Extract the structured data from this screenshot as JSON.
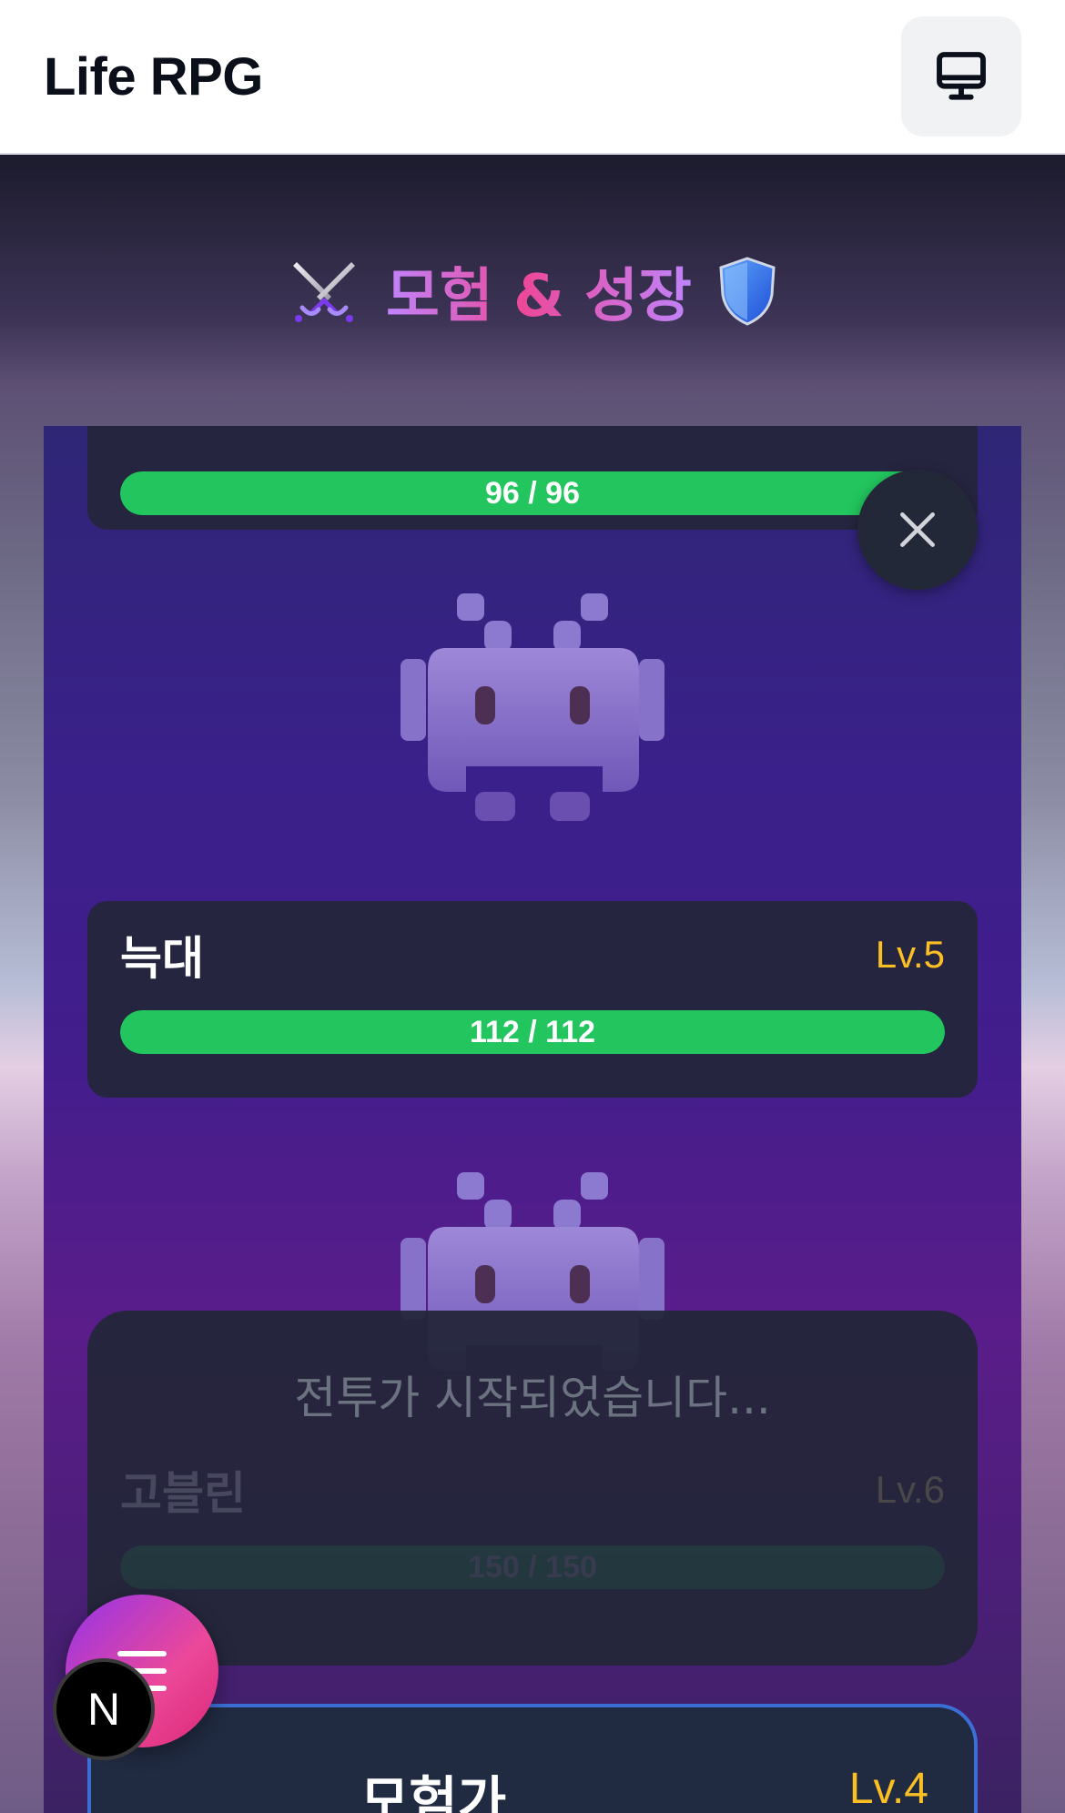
{
  "app": {
    "title": "Life RPG",
    "device_icon": "monitor-icon"
  },
  "header": {
    "title": "모험 & 성장",
    "left_icon": "crossed-swords-icon",
    "right_icon": "shield-icon"
  },
  "monsters": [
    {
      "name": "",
      "level": "",
      "hp_text": "96 / 96",
      "hp_fraction": 1.0
    },
    {
      "name": "늑대",
      "level": "Lv.5",
      "hp_text": "112 / 112",
      "hp_fraction": 1.0
    },
    {
      "name": "고블린",
      "level": "Lv.6",
      "hp_text": "150 / 150",
      "hp_fraction": 1.0
    }
  ],
  "battle_log": {
    "message": "전투가 시작되었습니다..."
  },
  "player": {
    "name": "모험가",
    "level": "Lv.4"
  },
  "fab": {
    "icon": "menu-icon"
  },
  "badge": {
    "letter": "N"
  },
  "colors": {
    "hp": "#22c55e",
    "level": "#fbbf24",
    "accent_pink": "#ec4899",
    "accent_purple": "#c084fc"
  }
}
